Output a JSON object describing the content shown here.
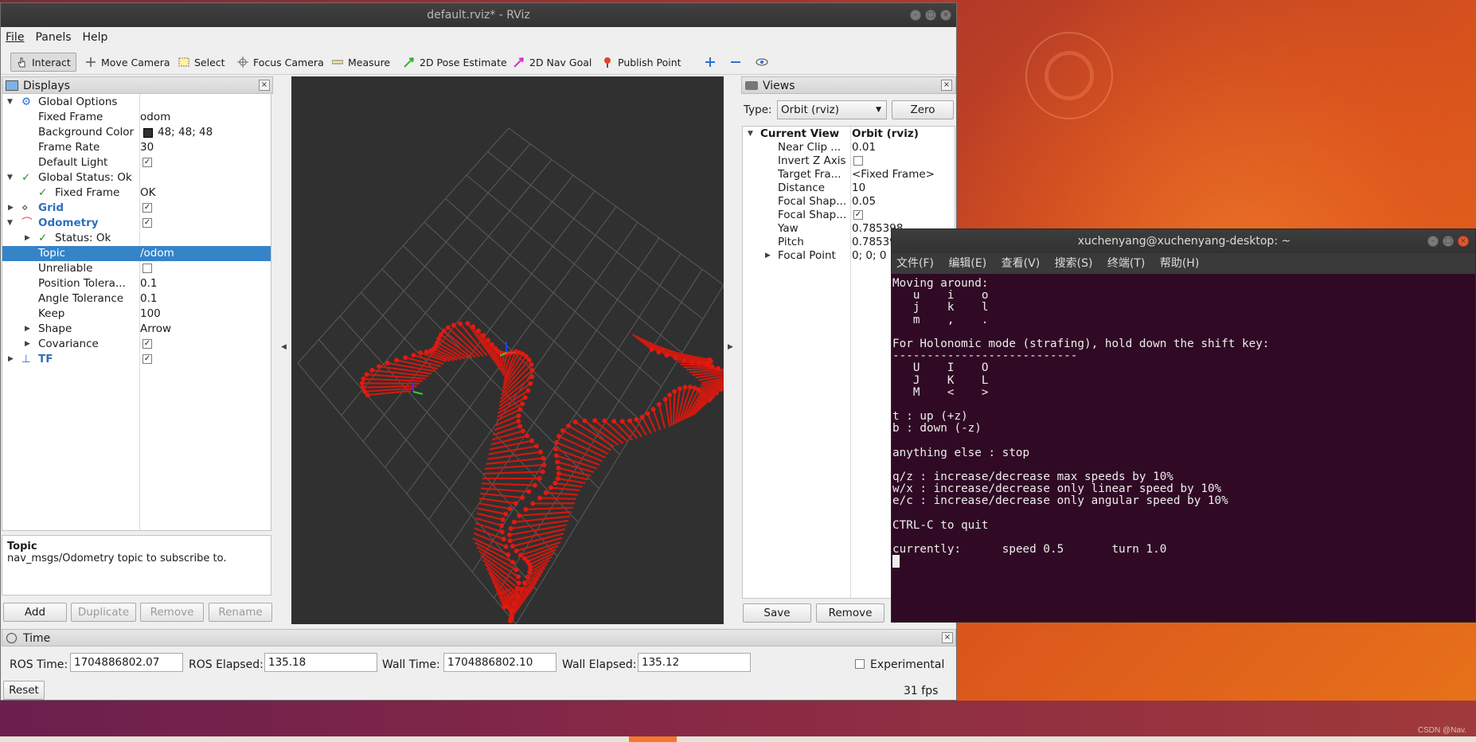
{
  "rviz": {
    "window_title": "default.rviz* - RViz",
    "menu": [
      "File",
      "Panels",
      "Help"
    ],
    "toolbar": {
      "interact": "Interact",
      "move_camera": "Move Camera",
      "select": "Select",
      "focus_camera": "Focus Camera",
      "measure": "Measure",
      "pose_estimate": "2D Pose Estimate",
      "nav_goal": "2D Nav Goal",
      "publish_point": "Publish Point"
    },
    "displays": {
      "title": "Displays",
      "global_options": "Global Options",
      "fixed_frame_key": "Fixed Frame",
      "fixed_frame_val": "odom",
      "bg_color_key": "Background Color",
      "bg_color_val": "48; 48; 48",
      "bg_color_hex": "#303030",
      "frame_rate_key": "Frame Rate",
      "frame_rate_val": "30",
      "default_light": "Default Light",
      "global_status": "Global Status: Ok",
      "fixed_frame_status": "Fixed Frame",
      "fixed_frame_status_val": "OK",
      "grid": "Grid",
      "odometry": "Odometry",
      "status_ok": "Status: Ok",
      "topic_key": "Topic",
      "topic_val": "/odom",
      "unreliable": "Unreliable",
      "pos_tol_key": "Position Tolera...",
      "pos_tol_val": "0.1",
      "ang_tol_key": "Angle Tolerance",
      "ang_tol_val": "0.1",
      "keep_key": "Keep",
      "keep_val": "100",
      "shape_key": "Shape",
      "shape_val": "Arrow",
      "covariance": "Covariance",
      "tf": "TF"
    },
    "description": {
      "title": "Topic",
      "text": "nav_msgs/Odometry topic to subscribe to."
    },
    "display_buttons": {
      "add": "Add",
      "duplicate": "Duplicate",
      "remove": "Remove",
      "rename": "Rename"
    },
    "views": {
      "title": "Views",
      "type_label": "Type:",
      "type_value": "Orbit (rviz)",
      "zero": "Zero",
      "current_view_key": "Current View",
      "current_view_val": "Orbit (rviz)",
      "near_clip_key": "Near Clip ...",
      "near_clip_val": "0.01",
      "invert_z": "Invert Z Axis",
      "target_frame_key": "Target Fra...",
      "target_frame_val": "<Fixed Frame>",
      "distance_key": "Distance",
      "distance_val": "10",
      "focal_shape1_key": "Focal Shap...",
      "focal_shape1_val": "0.05",
      "focal_shape2_key": "Focal Shap...",
      "yaw_key": "Yaw",
      "yaw_val": "0.785398",
      "pitch_key": "Pitch",
      "pitch_val": "0.78539",
      "focal_point_key": "Focal Point",
      "focal_point_val": "0; 0; 0",
      "save": "Save",
      "remove": "Remove"
    },
    "time": {
      "title": "Time",
      "ros_time_label": "ROS Time:",
      "ros_time": "1704886802.07",
      "ros_elapsed_label": "ROS Elapsed:",
      "ros_elapsed": "135.18",
      "wall_time_label": "Wall Time:",
      "wall_time": "1704886802.10",
      "wall_elapsed_label": "Wall Elapsed:",
      "wall_elapsed": "135.12",
      "experimental": "Experimental",
      "reset": "Reset",
      "fps": "31 fps"
    }
  },
  "terminal": {
    "title": "xuchenyang@xuchenyang-desktop: ~",
    "menu": [
      "文件(F)",
      "编辑(E)",
      "查看(V)",
      "搜索(S)",
      "终端(T)",
      "帮助(H)"
    ],
    "lines": [
      "Moving around:",
      "   u    i    o",
      "   j    k    l",
      "   m    ,    .",
      "",
      "For Holonomic mode (strafing), hold down the shift key:",
      "---------------------------",
      "   U    I    O",
      "   J    K    L",
      "   M    <    >",
      "",
      "t : up (+z)",
      "b : down (-z)",
      "",
      "anything else : stop",
      "",
      "q/z : increase/decrease max speeds by 10%",
      "w/x : increase/decrease only linear speed by 10%",
      "e/c : increase/decrease only angular speed by 10%",
      "",
      "CTRL-C to quit",
      "",
      "currently:\tspeed 0.5\tturn 1.0 "
    ]
  },
  "watermark": "CSDN @Nav."
}
